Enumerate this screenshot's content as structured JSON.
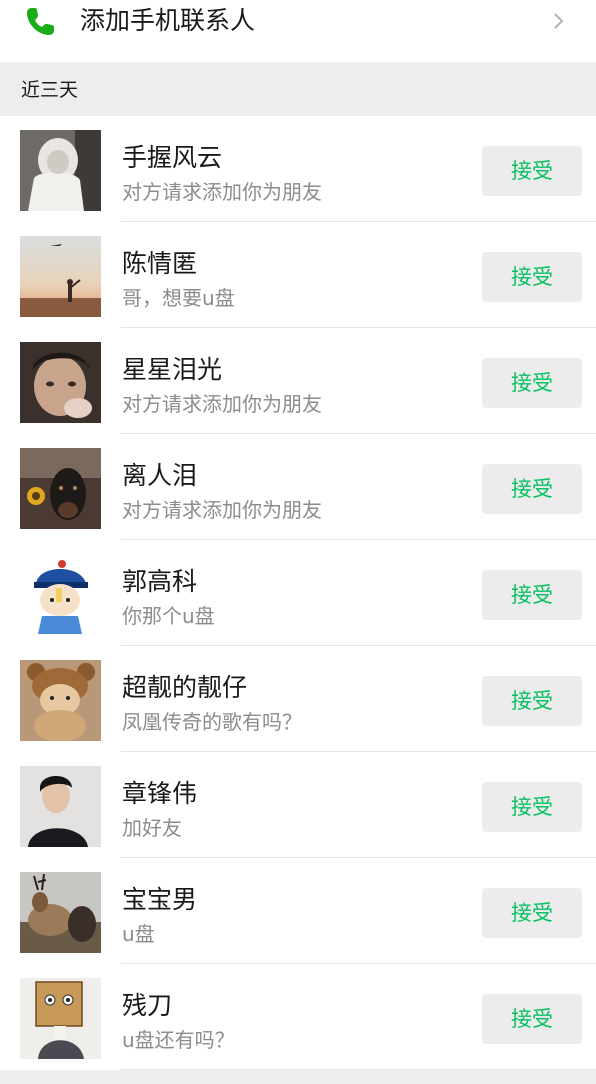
{
  "top": {
    "add_phone_contacts_label": "添加手机联系人",
    "phone_icon": "phone-icon",
    "chevron_icon": "chevron-right-icon"
  },
  "section": {
    "title": "近三天"
  },
  "colors": {
    "accent_green": "#07c160",
    "name_text": "#191919",
    "message_text": "#8c8c8c",
    "section_background": "#ededed",
    "button_background": "#ececec"
  },
  "requests": [
    {
      "name": "手握风云",
      "message": "对方请求添加你为朋友",
      "button": "接受",
      "avatar": "hooded-person-photo"
    },
    {
      "name": "陈情匿",
      "message": "哥，想要u盘",
      "button": "接受",
      "avatar": "sunset-plane-photo"
    },
    {
      "name": "星星泪光",
      "message": "对方请求添加你为朋友",
      "button": "接受",
      "avatar": "boy-face-photo"
    },
    {
      "name": "离人泪",
      "message": "对方请求添加你为朋友",
      "button": "接受",
      "avatar": "dog-sunflower-photo"
    },
    {
      "name": "郭高科",
      "message": "你那个u盘",
      "button": "接受",
      "avatar": "cartoon-qing-official"
    },
    {
      "name": "超靓的靓仔",
      "message": "凤凰传奇的歌有吗？",
      "button": "接受",
      "avatar": "cat-bear-costume-photo"
    },
    {
      "name": "章锋伟",
      "message": "加好友",
      "button": "接受",
      "avatar": "man-profile-photo"
    },
    {
      "name": "宝宝男",
      "message": "u盘",
      "button": "接受",
      "avatar": "deer-photo"
    },
    {
      "name": "残刀",
      "message": "u盘还有吗？",
      "button": "接受",
      "avatar": "box-head-cartoon"
    }
  ]
}
